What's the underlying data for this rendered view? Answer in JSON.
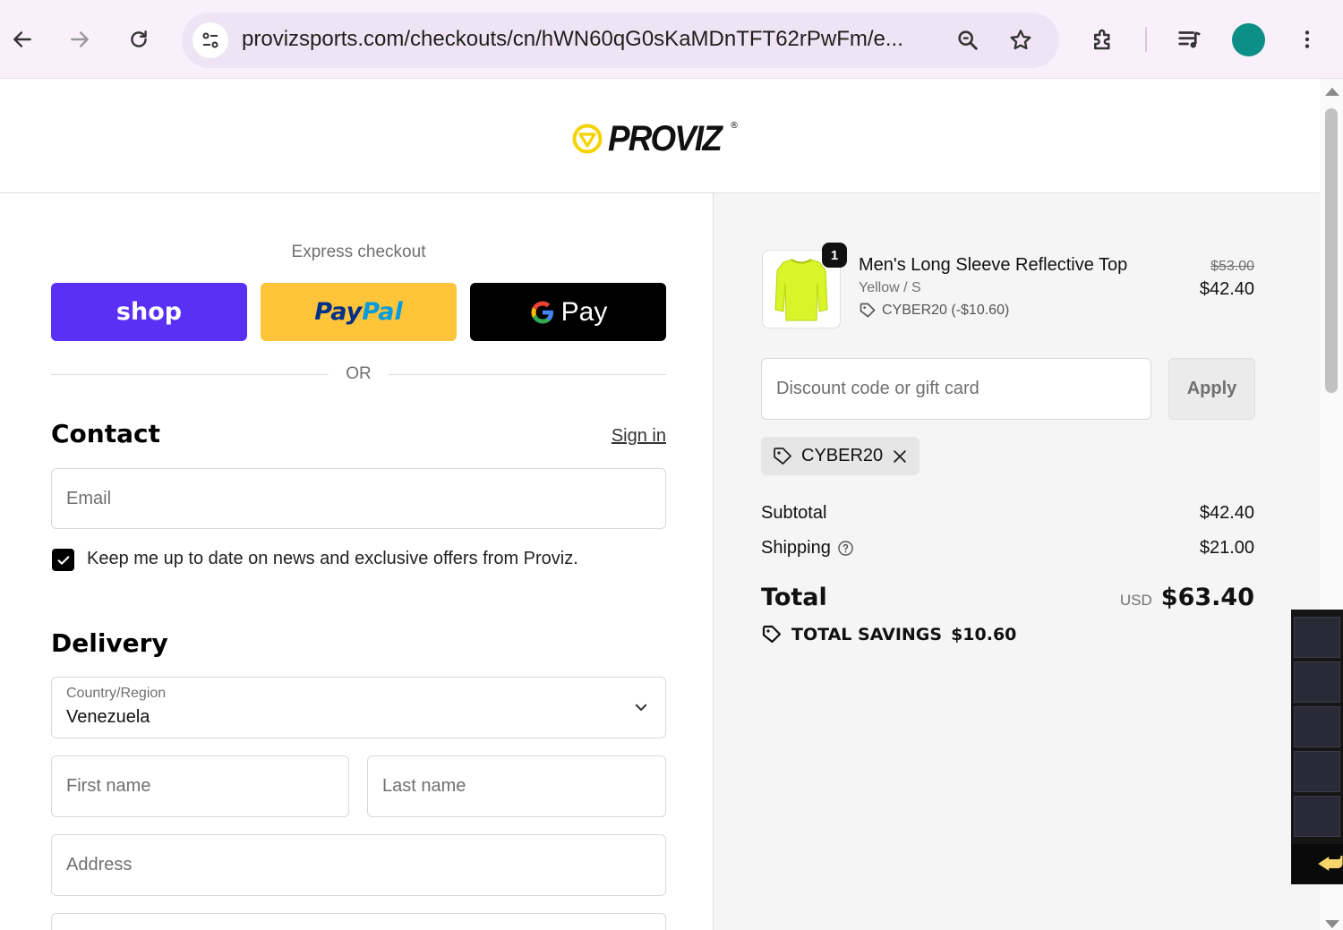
{
  "browser": {
    "url": "provizsports.com/checkouts/cn/hWN60qG0sKaMDnTFT62rPwFm/e..."
  },
  "header": {
    "logo_text": "PROVIZ",
    "logo_reg": "®"
  },
  "express": {
    "label": "Express checkout",
    "shop_label": "shop",
    "paypal_part1": "Pay",
    "paypal_part2": "Pal",
    "gpay_label": "Pay",
    "or_label": "OR"
  },
  "contact": {
    "title": "Contact",
    "signin_label": "Sign in",
    "email_placeholder": "Email",
    "newsletter_checked": true,
    "newsletter_label": "Keep me up to date on news and exclusive offers from Proviz."
  },
  "delivery": {
    "title": "Delivery",
    "country_label": "Country/Region",
    "country_value": "Venezuela",
    "first_name_placeholder": "First name",
    "last_name_placeholder": "Last name",
    "address_placeholder": "Address"
  },
  "order": {
    "item": {
      "quantity": "1",
      "name": "Men's Long Sleeve Reflective Top",
      "variant": "Yellow / S",
      "discount": "CYBER20 (-$10.60)",
      "original_price": "$53.00",
      "price": "$42.40"
    },
    "discount_placeholder": "Discount code or gift card",
    "apply_label": "Apply",
    "applied_code": "CYBER20",
    "subtotal_label": "Subtotal",
    "subtotal_value": "$42.40",
    "shipping_label": "Shipping",
    "shipping_value": "$21.00",
    "total_label": "Total",
    "total_currency": "USD",
    "total_value": "$63.40",
    "savings_label": "TOTAL SAVINGS",
    "savings_value": "$10.60"
  },
  "colors": {
    "shop_purple": "#5a31f4",
    "paypal_yellow": "#ffc439",
    "logo_yellow": "#f5d300",
    "product_yellow": "#d8f52a"
  }
}
